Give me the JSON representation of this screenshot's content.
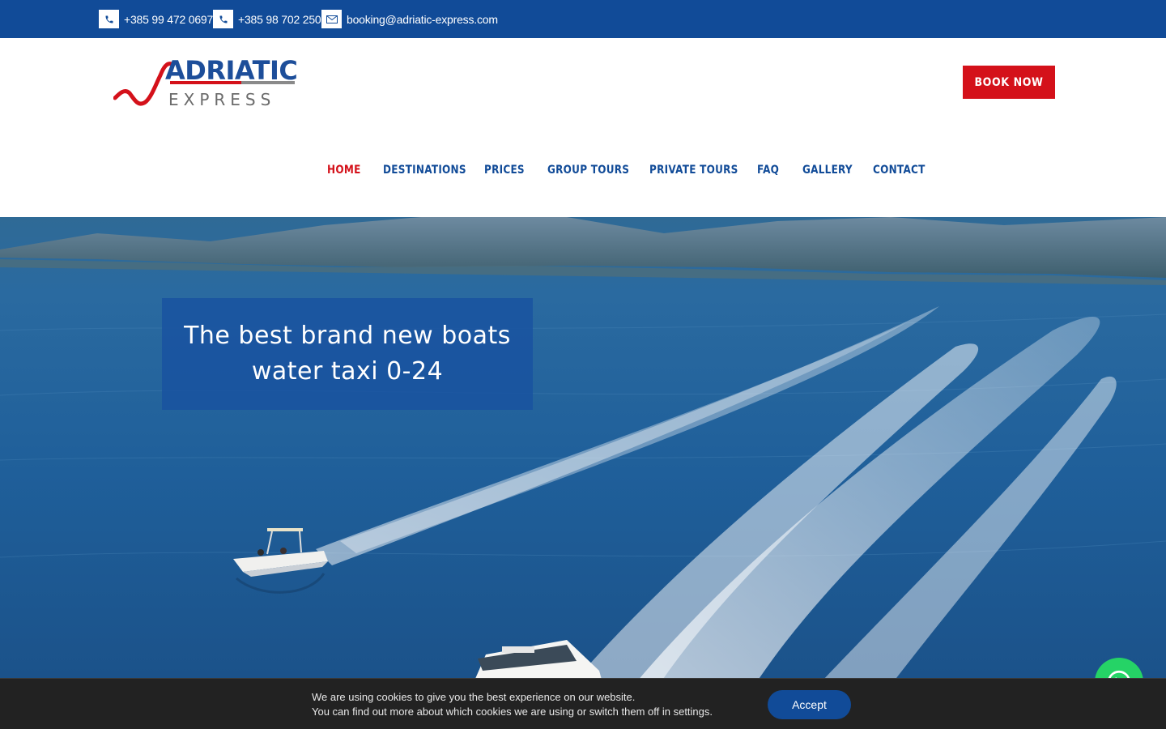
{
  "topbar": {
    "phone1": "+385 99 472 0697",
    "phone2": "+385 98 702 250",
    "email": "booking@adriatic-express.com",
    "icons": [
      "phone-icon",
      "phone-icon",
      "envelope-icon"
    ]
  },
  "header": {
    "logo_line1": "ADRIATIC",
    "logo_line2": "EXPRESS",
    "book_label": "BOOK NOW"
  },
  "nav": {
    "items": [
      {
        "label": "HOME",
        "active": true
      },
      {
        "label": "DESTINATIONS",
        "active": false
      },
      {
        "label": "PRICES",
        "active": false
      },
      {
        "label": "GROUP TOURS",
        "active": false
      },
      {
        "label": "PRIVATE TOURS",
        "active": false
      },
      {
        "label": "FAQ",
        "active": false
      },
      {
        "label": "GALLERY",
        "active": false
      },
      {
        "label": "CONTACT",
        "active": false
      }
    ]
  },
  "hero": {
    "headline_line1": "The best brand new boats",
    "headline_line2": "water taxi 0-24"
  },
  "cookie": {
    "line1": "We are using cookies to give you the best experience on our website.",
    "line2": "You can find out more about which cookies we are using or switch them off in settings.",
    "accept_label": "Accept"
  },
  "colors": {
    "brand_blue": "#114b98",
    "brand_red": "#d4111a",
    "cookie_bg": "#222222"
  }
}
